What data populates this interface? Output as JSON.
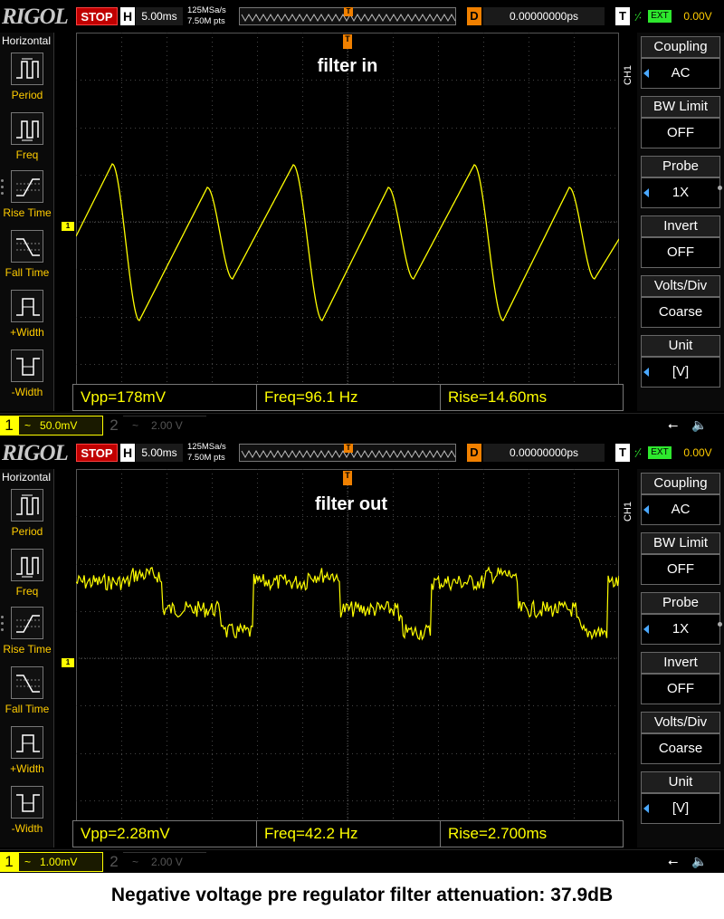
{
  "scopes": [
    {
      "logo": "RIGOL",
      "run_state": "STOP",
      "timebase_badge": "H",
      "timebase": "5.00ms",
      "sample_rate": "125MSa/s",
      "memory_depth": "7.50M pts",
      "trigger_pos_marker": "T",
      "delay_badge": "D",
      "delay": "0.00000000ps",
      "trigger_badge": "T",
      "trigger_edge_icon": "rising-edge-icon",
      "trigger_source": "EXT",
      "trigger_level": "0.00V",
      "left_menu": {
        "title": "Horizontal",
        "items": [
          {
            "label": "Period",
            "icon": "period-icon"
          },
          {
            "label": "Freq",
            "icon": "freq-icon"
          },
          {
            "label": "Rise Time",
            "icon": "rise-time-icon"
          },
          {
            "label": "Fall Time",
            "icon": "fall-time-icon"
          },
          {
            "label": "+Width",
            "icon": "pos-width-icon"
          },
          {
            "label": "-Width",
            "icon": "neg-width-icon"
          }
        ]
      },
      "screen_label": "filter in",
      "channel_marker": "1",
      "trigger_marker": "T",
      "measurements": {
        "vpp": "Vpp=178mV",
        "freq": "Freq=96.1 Hz",
        "rise": "Rise=14.60ms"
      },
      "channel_tag": "CH1",
      "right_menu": [
        {
          "title": "Coupling",
          "value": "AC",
          "arrow": true
        },
        {
          "title": "BW Limit",
          "value": "OFF",
          "arrow": false
        },
        {
          "title": "Probe",
          "value": "1X",
          "arrow": true
        },
        {
          "title": "Invert",
          "value": "OFF",
          "arrow": false
        },
        {
          "title": "Volts/Div",
          "value": "Coarse",
          "arrow": false
        },
        {
          "title": "Unit",
          "value": "[V]",
          "arrow": true
        }
      ],
      "status": {
        "ch1_num": "1",
        "ch1_coupling": "~",
        "ch1_scale": "50.0mV",
        "ch2_num": "2",
        "ch2_coupling": "~",
        "ch2_scale": "2.00 V",
        "usb_icon": "usb-icon",
        "speaker_icon": "speaker-icon"
      },
      "trace": {
        "type": "triangle",
        "color": "#ffff00"
      }
    },
    {
      "logo": "RIGOL",
      "run_state": "STOP",
      "timebase_badge": "H",
      "timebase": "5.00ms",
      "sample_rate": "125MSa/s",
      "memory_depth": "7.50M pts",
      "trigger_pos_marker": "T",
      "delay_badge": "D",
      "delay": "0.00000000ps",
      "trigger_badge": "T",
      "trigger_edge_icon": "rising-edge-icon",
      "trigger_source": "EXT",
      "trigger_level": "0.00V",
      "left_menu": {
        "title": "Horizontal",
        "items": [
          {
            "label": "Period",
            "icon": "period-icon"
          },
          {
            "label": "Freq",
            "icon": "freq-icon"
          },
          {
            "label": "Rise Time",
            "icon": "rise-time-icon"
          },
          {
            "label": "Fall Time",
            "icon": "fall-time-icon"
          },
          {
            "label": "+Width",
            "icon": "pos-width-icon"
          },
          {
            "label": "-Width",
            "icon": "neg-width-icon"
          }
        ]
      },
      "screen_label": "filter out",
      "channel_marker": "1",
      "trigger_marker": "T",
      "measurements": {
        "vpp": "Vpp=2.28mV",
        "freq": "Freq=42.2 Hz",
        "rise": "Rise=2.700ms"
      },
      "channel_tag": "CH1",
      "right_menu": [
        {
          "title": "Coupling",
          "value": "AC",
          "arrow": true
        },
        {
          "title": "BW Limit",
          "value": "OFF",
          "arrow": false
        },
        {
          "title": "Probe",
          "value": "1X",
          "arrow": true
        },
        {
          "title": "Invert",
          "value": "OFF",
          "arrow": false
        },
        {
          "title": "Volts/Div",
          "value": "Coarse",
          "arrow": false
        },
        {
          "title": "Unit",
          "value": "[V]",
          "arrow": true
        }
      ],
      "status": {
        "ch1_num": "1",
        "ch1_coupling": "~",
        "ch1_scale": "1.00mV",
        "ch2_num": "2",
        "ch2_coupling": "~",
        "ch2_scale": "2.00 V",
        "usb_icon": "usb-icon",
        "speaker_icon": "speaker-icon"
      },
      "trace": {
        "type": "noisy",
        "color": "#ffff00"
      }
    }
  ],
  "caption": "Negative voltage pre regulator filter attenuation: 37.9dB"
}
